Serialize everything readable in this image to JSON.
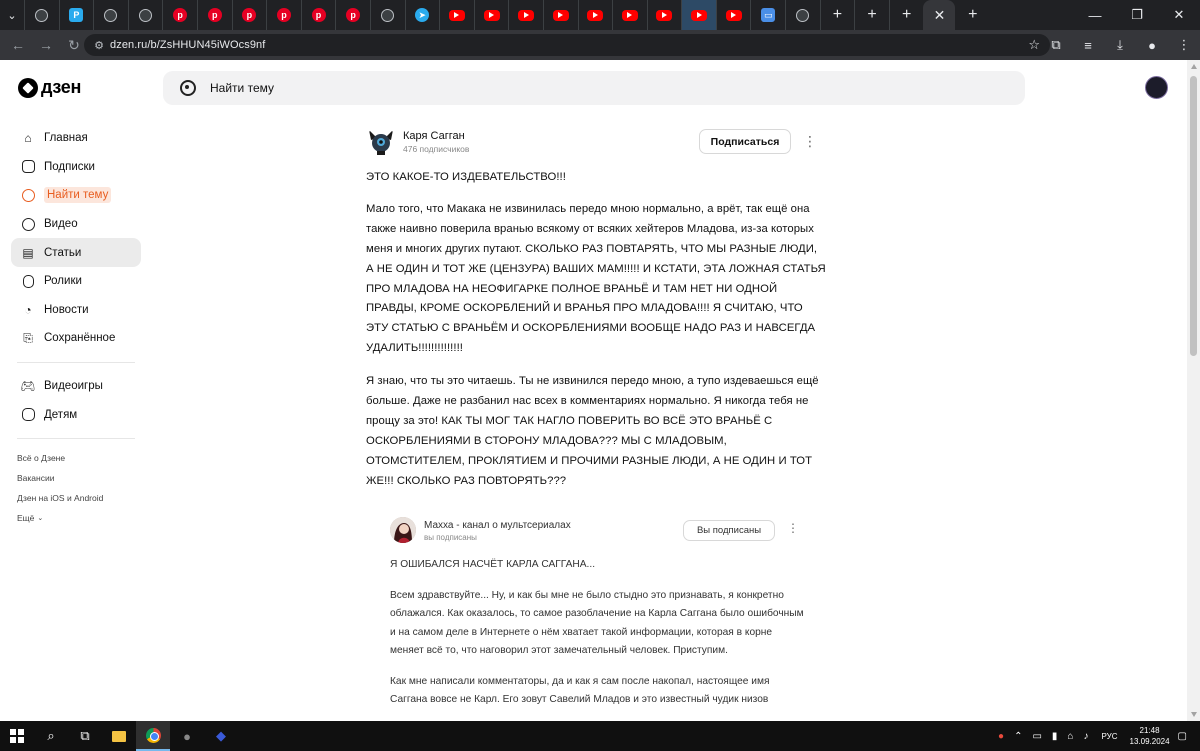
{
  "browser": {
    "url": "dzen.ru/b/ZsHHUN45iWOcs9nf",
    "tab_count": 26,
    "new_tab_symbol": "+",
    "close_tab_symbol": "✕",
    "tab_menu_symbol": "⌄",
    "window_controls": [
      "—",
      "❐",
      "✕"
    ]
  },
  "dzen": {
    "logo_text": "дзен",
    "search_placeholder": "Найти тему"
  },
  "sidebar": {
    "items": [
      {
        "label": "Главная",
        "icon": "home-icon"
      },
      {
        "label": "Подписки",
        "icon": "subscriptions-icon"
      },
      {
        "label": "Найти тему",
        "icon": "find-topic-icon"
      },
      {
        "label": "Видео",
        "icon": "video-icon"
      },
      {
        "label": "Статьи",
        "icon": "articles-icon"
      },
      {
        "label": "Ролики",
        "icon": "shorts-icon"
      },
      {
        "label": "Новости",
        "icon": "news-icon"
      },
      {
        "label": "Сохранённое",
        "icon": "bookmark-icon"
      }
    ],
    "items2": [
      {
        "label": "Видеоигры",
        "icon": "gamepad-icon"
      },
      {
        "label": "Детям",
        "icon": "kids-icon"
      }
    ],
    "footer": [
      "Всё о Дзене",
      "Вакансии",
      "Дзен на iOS и Android",
      "Ещё"
    ],
    "active_index": 4,
    "highlight_index": 2,
    "accent_color": "#e85d20"
  },
  "article": {
    "author": "Каря Сагган",
    "subscribers": "476 подписчиков",
    "subscribe_label": "Подписаться",
    "more_symbol": "⋮",
    "headline": "ЭТО КАКОЕ-ТО ИЗДЕВАТЕЛЬСТВО!!!",
    "paragraph1": "Мало того, что Макака не извинилась передо мною нормально, а врёт, так ещё она также наивно поверила вранью всякому от всяких хейтеров Младова, из-за которых меня и многих других путают. СКОЛЬКО РАЗ ПОВТАРЯТЬ, ЧТО МЫ РАЗНЫЕ ЛЮДИ, А НЕ ОДИН И ТОТ ЖЕ (ЦЕНЗУРА) ВАШИХ МАМ!!!!! И КСТАТИ, ЭТА ЛОЖНАЯ СТАТЬЯ ПРО МЛАДОВА НА НЕОФИГАРКЕ ПОЛНОЕ ВРАНЬЁ И ТАМ НЕТ НИ ОДНОЙ ПРАВДЫ, КРОМЕ ОСКОРБЛЕНИЙ И ВРАНЬЯ ПРО МЛАДОВА!!!! Я СЧИТАЮ, ЧТО ЭТУ СТАТЬЮ С ВРАНЬЁМ И ОСКОРБЛЕНИЯМИ ВООБЩЕ НАДО РАЗ И НАВСЕГДА УДАЛИТЬ!!!!!!!!!!!!!!",
    "paragraph2": "Я знаю, что ты это читаешь. Ты не извинился передо мною, а тупо издеваешься ещё больше. Даже не разбанил нас всех в комментариях нормально. Я никогда тебя не прощу за это! КАК ТЫ МОГ ТАК НАГЛО ПОВЕРИТЬ ВО ВСЁ ЭТО ВРАНЬЁ С ОСКОРБЛЕНИЯМИ В СТОРОНУ МЛАДОВА??? МЫ С МЛАДОВЫМ, ОТОМСТИТЕЛЕМ, ПРОКЛЯТИЕМ И ПРОЧИМИ РАЗНЫЕ ЛЮДИ, А НЕ ОДИН И ТОТ ЖЕ!!! СКОЛЬКО РАЗ ПОВТОРЯТЬ???"
  },
  "embed": {
    "channel": "Махха - канал о мультсериалах",
    "subs_status": "вы подписаны",
    "button_label": "Вы подписаны",
    "headline": "Я ОШИБАЛСЯ НАСЧЁТ КАРЛА САГГАНА...",
    "paragraph1": "Всем здравствуйте... Ну, и как бы мне не было стыдно это признавать, я конкретно облажался. Как оказалось, то самое разоблачение на Карла Саггана было ошибочным и на самом деле в Интернете о нём хватает такой информации, которая в корне меняет всё то, что наговорил этот замечательный человек. Приступим.",
    "paragraph2": "Как мне написали комментаторы, да и как я сам после накопал, настоящее имя Саггана вовсе не Карл. Его зовут Савелий Младов и это известный чудик низов"
  },
  "taskbar": {
    "language": "РУС",
    "time": "21:48",
    "date": "13.09.2024"
  }
}
